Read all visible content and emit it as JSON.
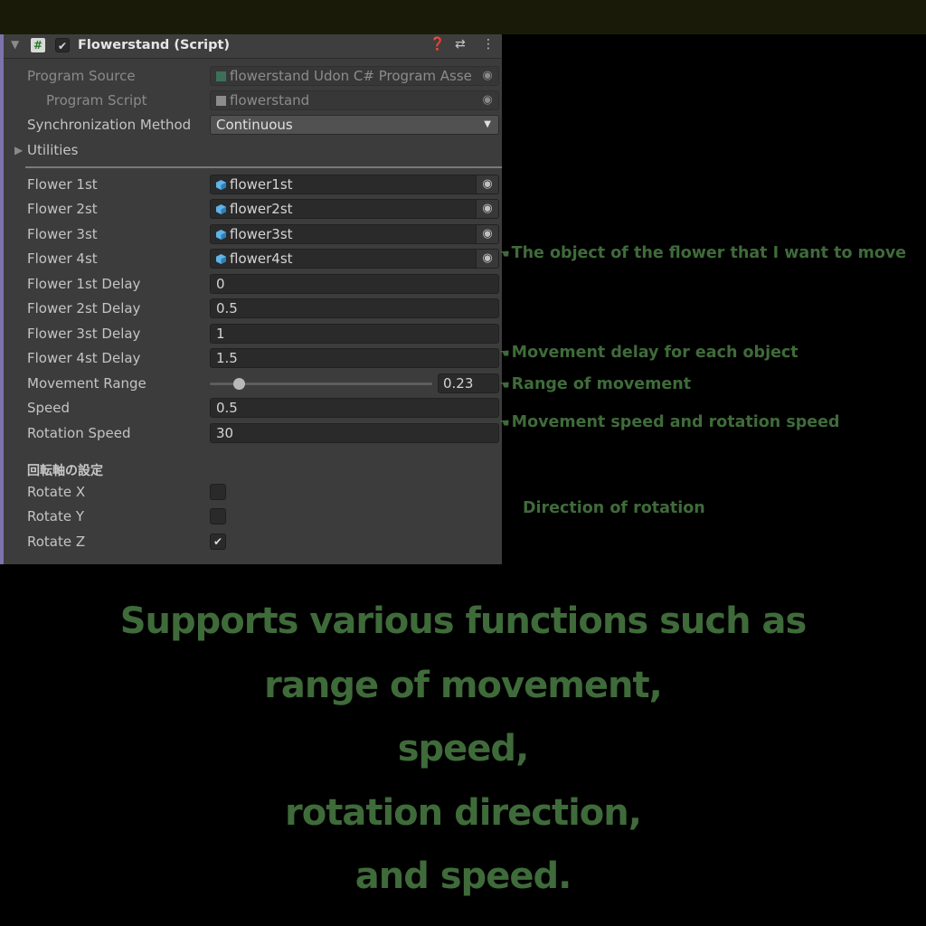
{
  "header": {
    "title": "Flowerstand (Script)",
    "enabled": true,
    "help_icon": "help-icon",
    "presets_icon": "presets-icon",
    "menu_icon": "kebab-menu-icon"
  },
  "program": {
    "source_label": "Program Source",
    "source_value": "flowerstand Udon C# Program Asse",
    "script_label": "Program Script",
    "script_value": "flowerstand",
    "sync_label": "Synchronization Method",
    "sync_value": "Continuous",
    "utilities_label": "Utilities"
  },
  "flowers": [
    {
      "label": "Flower 1st",
      "value": "flower1st"
    },
    {
      "label": "Flower 2st",
      "value": "flower2st"
    },
    {
      "label": "Flower 3st",
      "value": "flower3st"
    },
    {
      "label": "Flower 4st",
      "value": "flower4st"
    }
  ],
  "delays": [
    {
      "label": "Flower 1st Delay",
      "value": "0"
    },
    {
      "label": "Flower 2st Delay",
      "value": "0.5"
    },
    {
      "label": "Flower 3st Delay",
      "value": "1"
    },
    {
      "label": "Flower 4st Delay",
      "value": "1.5"
    }
  ],
  "movement_range": {
    "label": "Movement Range",
    "value": "0.23",
    "fraction": 0.13
  },
  "speed": {
    "label": "Speed",
    "value": "0.5"
  },
  "rotation_speed": {
    "label": "Rotation Speed",
    "value": "30"
  },
  "rotation_axis": {
    "section_label": "回転軸の設定",
    "items": [
      {
        "label": "Rotate X",
        "checked": false
      },
      {
        "label": "Rotate Y",
        "checked": false
      },
      {
        "label": "Rotate Z",
        "checked": true
      }
    ]
  },
  "annotations": {
    "flower_object": "The object of the flower that I want to move",
    "delay": "Movement delay for each object",
    "range": "Range of movement",
    "speed": "Movement speed and rotation speed",
    "direction": "Direction of rotation"
  },
  "caption": {
    "line1": "Supports various functions such as",
    "line2": "range of movement,",
    "line3": "speed,",
    "line4": "rotation direction,",
    "line5": "and speed."
  },
  "colors": {
    "accent_bar": "#7e73ad",
    "annotation_green": "#3f6b3a",
    "object_icon": "#5fb3e8"
  }
}
